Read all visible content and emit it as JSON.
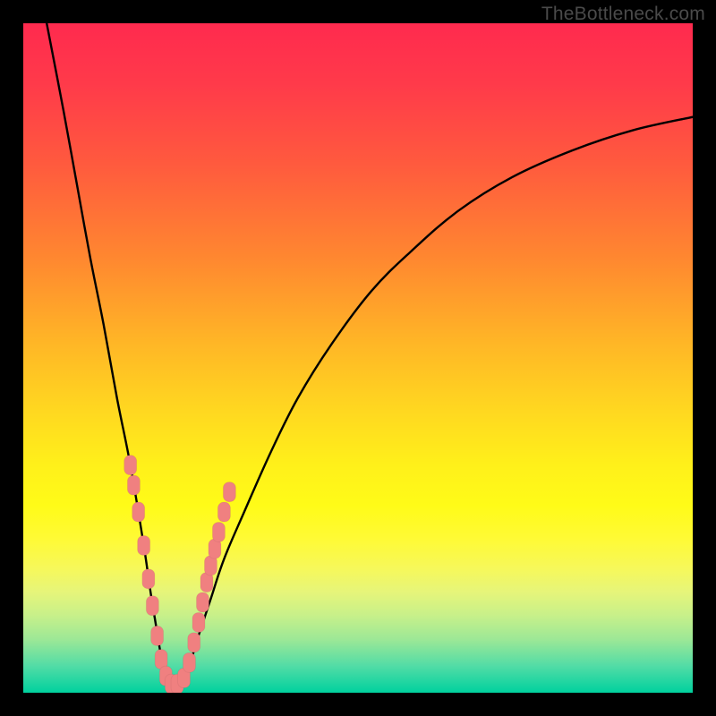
{
  "watermark": "TheBottleneck.com",
  "colors": {
    "frame": "#000000",
    "curve": "#000000",
    "marker_fill": "#f08080",
    "marker_stroke": "rgba(0,0,0,0.05)",
    "gradient_top": "#ff2a4e",
    "gradient_bottom": "#00d19e"
  },
  "chart_data": {
    "type": "line",
    "title": "",
    "xlabel": "",
    "ylabel": "",
    "xlim": [
      0,
      100
    ],
    "ylim": [
      0,
      100
    ],
    "note": "V-shaped bottleneck curve over a smooth red→yellow→green vertical gradient. Y values are approximate percentages inferred from the image (100 = top/red, 0 = bottom/green). The vertex of the V sits near x≈22, y≈0.",
    "series": [
      {
        "name": "bottleneck_curve",
        "x": [
          3.5,
          6,
          8,
          10,
          12,
          14,
          16,
          18,
          19.5,
          21.5,
          24,
          26,
          28,
          30,
          33,
          37,
          41,
          46,
          52,
          58,
          65,
          73,
          82,
          91,
          100
        ],
        "y": [
          100,
          87,
          76,
          65,
          55,
          44,
          34,
          22,
          12,
          2,
          2,
          8,
          14,
          20,
          27,
          36,
          44,
          52,
          60,
          66,
          72,
          77,
          81,
          84,
          86
        ]
      }
    ],
    "markers": {
      "name": "highlighted_points",
      "note": "Salmon pill-shaped markers clustered near the vertex, approximate positions.",
      "x": [
        16.0,
        16.5,
        17.2,
        18.0,
        18.7,
        19.3,
        20.0,
        20.6,
        21.3,
        22.1,
        23.0,
        24.0,
        24.8,
        25.5,
        26.2,
        26.8,
        27.4,
        28.0,
        28.6,
        29.2,
        30.0,
        30.8
      ],
      "y": [
        34.0,
        31.0,
        27.0,
        22.0,
        17.0,
        13.0,
        8.5,
        5.0,
        2.5,
        1.3,
        1.3,
        2.2,
        4.5,
        7.5,
        10.5,
        13.5,
        16.5,
        19.0,
        21.5,
        24.0,
        27.0,
        30.0
      ]
    }
  }
}
